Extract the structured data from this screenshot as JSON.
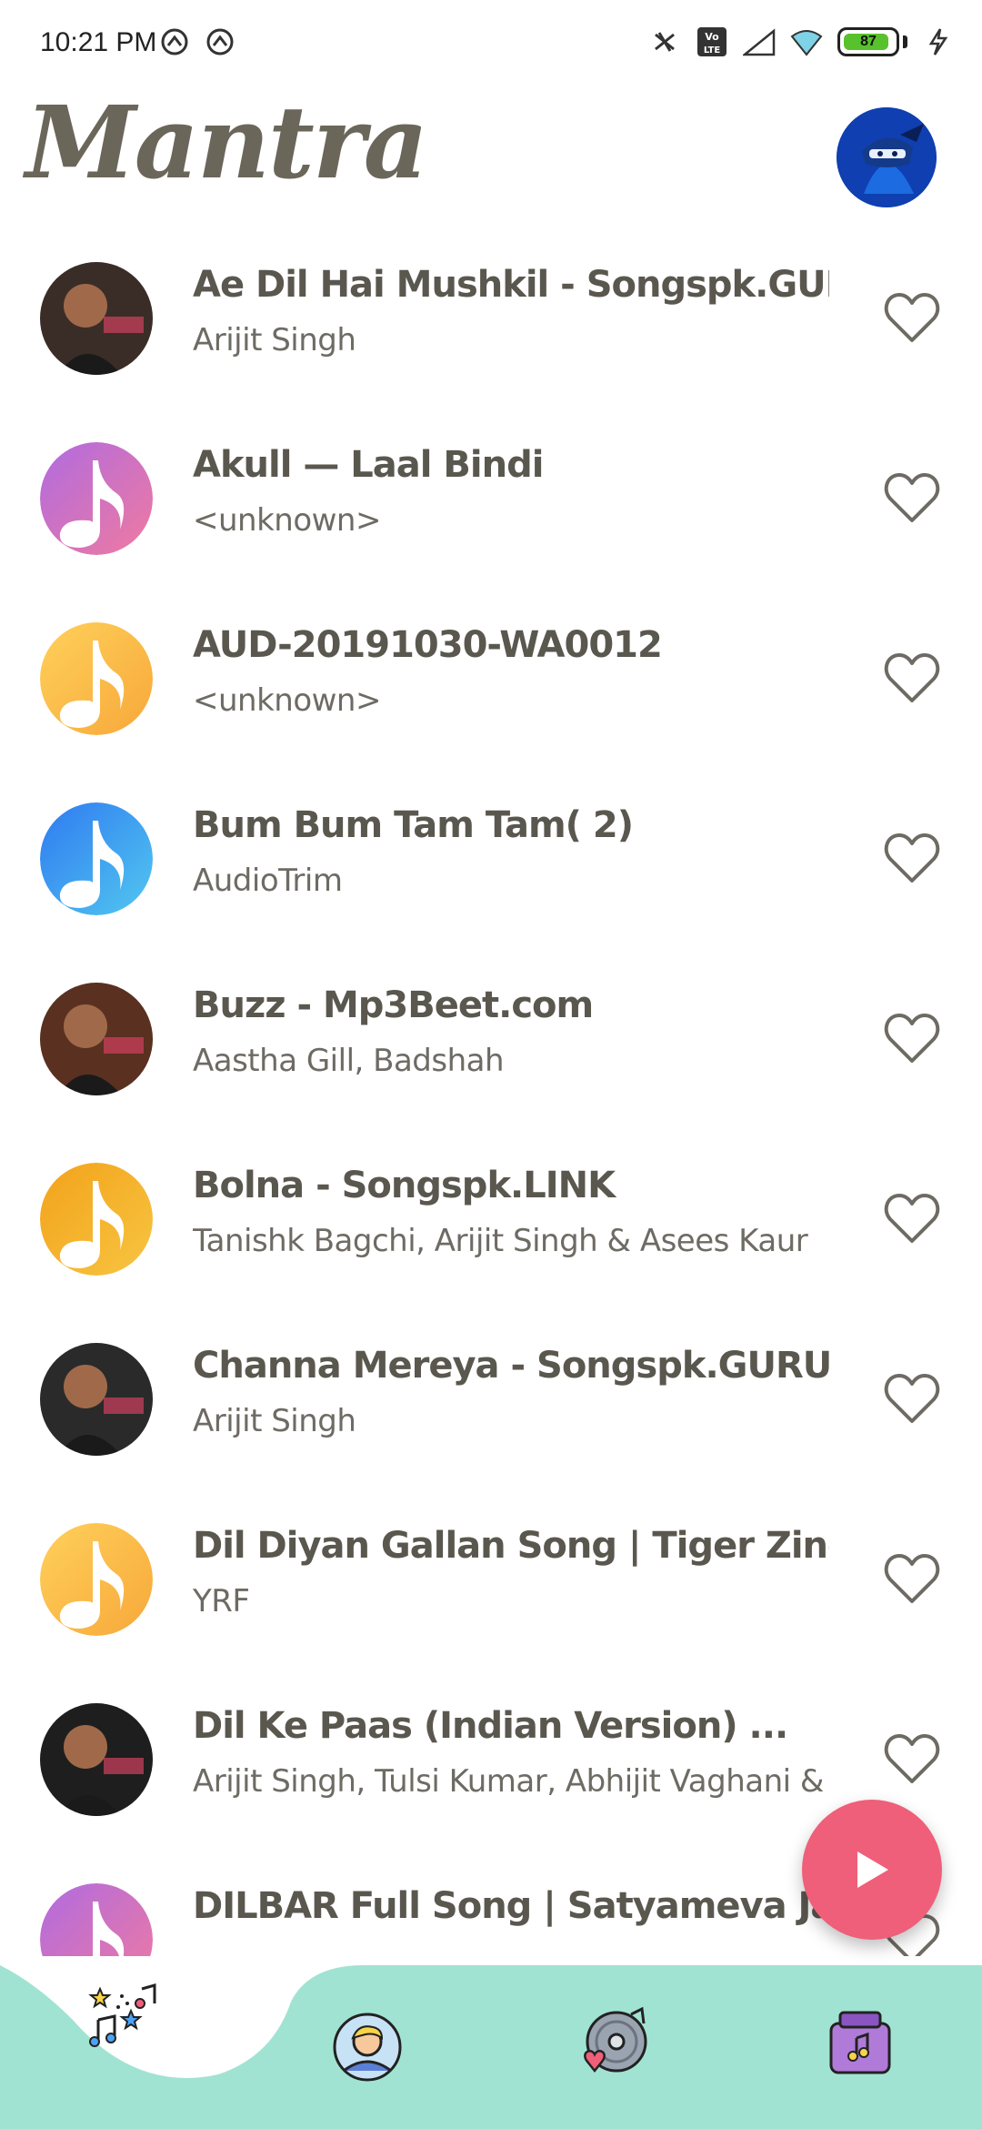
{
  "status_bar": {
    "time": "10:21 PM",
    "battery_level": "87",
    "icons": [
      "sync-icon",
      "sync-icon",
      "mute-icon",
      "volte-icon",
      "signal-icon",
      "wifi-icon",
      "battery-icon",
      "charging-icon"
    ]
  },
  "header": {
    "app_title": "Mantra",
    "profile_icon": "ninja-avatar-icon"
  },
  "songs": [
    {
      "title": "Ae Dil Hai Mushkil - Songspk.GURU",
      "artist": "Arijit Singh",
      "art": "album-photo"
    },
    {
      "title": "Akull — Laal Bindi",
      "artist": "<unknown>",
      "art": "music-note-purple"
    },
    {
      "title": "AUD-20191030-WA0012",
      "artist": "<unknown>",
      "art": "music-note-yellow"
    },
    {
      "title": "Bum Bum Tam Tam( 2)",
      "artist": "AudioTrim",
      "art": "music-note-blue"
    },
    {
      "title": "Buzz - Mp3Beet.com",
      "artist": "Aastha Gill, Badshah",
      "art": "album-photo"
    },
    {
      "title": "Bolna - Songspk.LINK",
      "artist": "Tanishk Bagchi, Arijit Singh & Asees Kaur",
      "art": "music-note-orange"
    },
    {
      "title": "Channa Mereya - Songspk.GURU",
      "artist": "Arijit Singh",
      "art": "album-photo"
    },
    {
      "title": "Dil Diyan Gallan Song | Tiger Zinda Hai | ...",
      "artist": "YRF",
      "art": "music-note-yellow"
    },
    {
      "title": "Dil Ke Paas (Indian Version) ...",
      "artist": "Arijit Singh, Tulsi Kumar, Abhijit Vaghani & ...",
      "art": "album-photo"
    },
    {
      "title": "DILBAR Full Song | Satyameva Jayate | ...",
      "artist": "",
      "art": "music-note-purple"
    }
  ],
  "fab": {
    "icon": "play-icon"
  },
  "bottom_nav": {
    "items": [
      {
        "name": "songs",
        "icon": "music-notes-icon",
        "active": true
      },
      {
        "name": "artists",
        "icon": "person-icon",
        "active": false
      },
      {
        "name": "favorites",
        "icon": "vinyl-heart-icon",
        "active": false
      },
      {
        "name": "library",
        "icon": "music-box-icon",
        "active": false
      }
    ]
  },
  "colors": {
    "accent": "#ef5f79",
    "nav_background": "#a1e3d2",
    "title": "#6b665a"
  }
}
